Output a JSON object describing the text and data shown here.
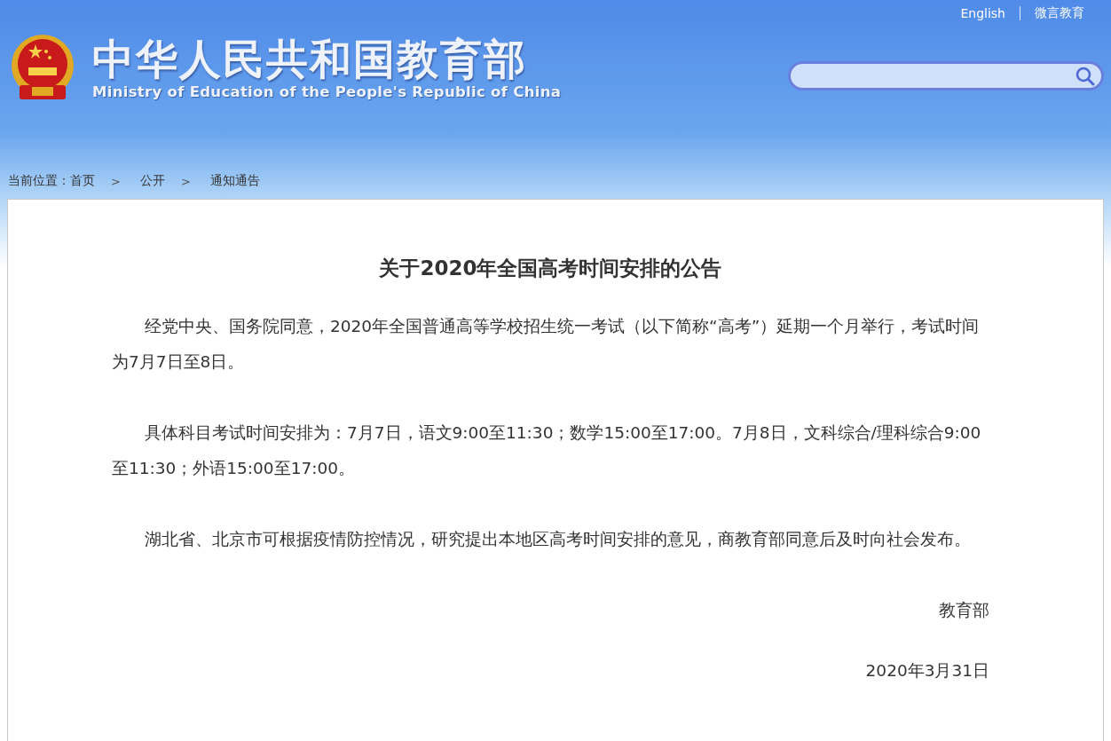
{
  "header": {
    "title": "中华人民共和国教育部",
    "subtitle": "Ministry of Education of the People's Republic of China",
    "links": [
      {
        "label": "English"
      },
      {
        "label": "微言教育"
      }
    ]
  },
  "breadcrumb": {
    "prefix": "当前位置：",
    "items": [
      {
        "label": "首页",
        "separator": ">"
      },
      {
        "label": "公开",
        "separator": ">"
      },
      {
        "label": "通知通告"
      }
    ]
  },
  "article": {
    "title": "关于2020年全国高考时间安排的公告",
    "paragraphs": [
      "经党中央、国务院同意，2020年全国普通高等学校招生统一考试（以下简称“高考”）延期一个月举行，考试时间为7月7日至8日。",
      "具体科目考试时间安排为：7月7日，语文9:00至11:30；数学15:00至17:00。7月8日，文科综合/理科综合9:00至11:30；外语15:00至17:00。",
      "湖北省、北京市可根据疫情防控情况，研究提出本地区高考时间安排的意见，商教育部同意后及时向社会发布。"
    ],
    "signature": "教育部",
    "date": "2020年3月31日"
  }
}
